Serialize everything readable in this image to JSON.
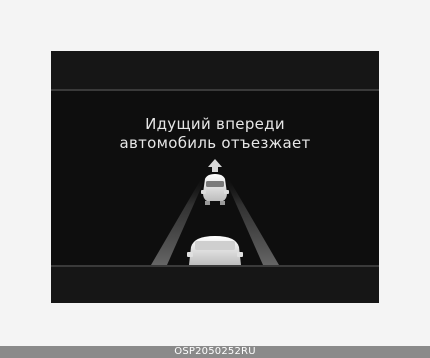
{
  "display": {
    "message_line1": "Идущий впереди",
    "message_line2": "автомобиль отъезжает"
  },
  "scene": {
    "lead_vehicle_icon": "car-rear-icon",
    "own_vehicle_icon": "car-rear-icon",
    "direction_icon": "arrow-up-icon",
    "lane_color": "#5a5a5a",
    "vehicle_color": "#e8e8e8"
  },
  "caption": {
    "code": "OSP2050252RU"
  }
}
